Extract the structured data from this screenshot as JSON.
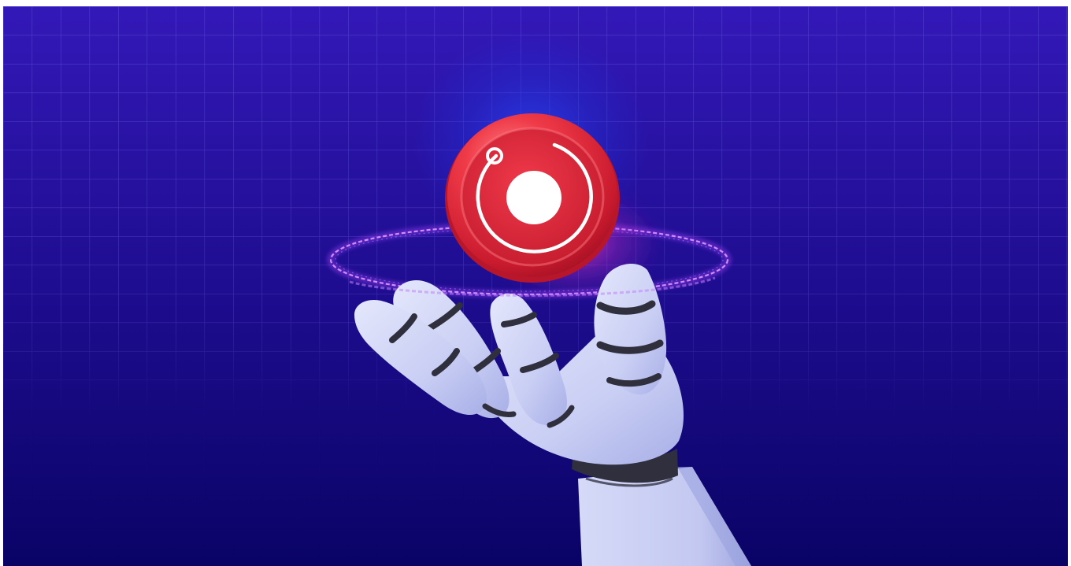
{
  "scene": {
    "subject": "robot-hand-holding-token",
    "icon": "coin-orbit-icon",
    "colors": {
      "background_top": "#3318b8",
      "background_bottom": "#0a0366",
      "grid_line": "#6a5ce0",
      "coin_red": "#e5283b",
      "coin_dark": "#9e0f22",
      "ring_glow": "#c54bff",
      "hand_light": "#cfd4f6",
      "hand_shadow": "#9aa2e0",
      "joint_dark": "#2f2f3d"
    }
  }
}
